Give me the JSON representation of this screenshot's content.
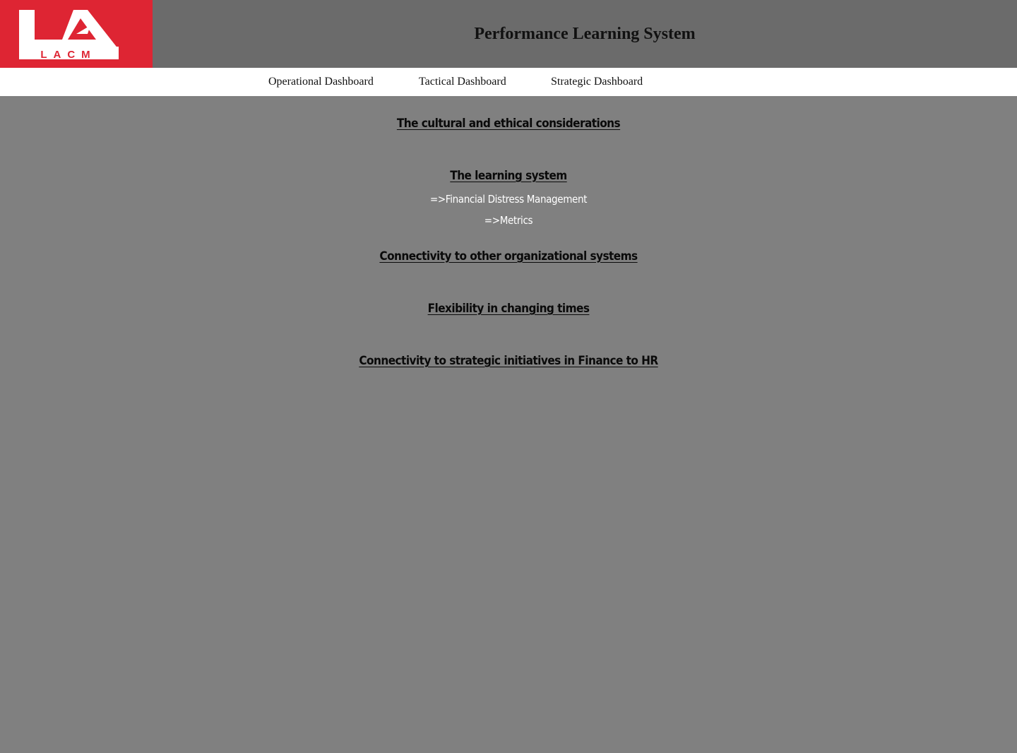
{
  "header": {
    "logo_text": "LACM",
    "title": "Performance Learning System",
    "brand_color": "#de2533"
  },
  "nav": {
    "items": [
      {
        "label": "Operational Dashboard"
      },
      {
        "label": "Tactical Dashboard"
      },
      {
        "label": "Strategic Dashboard"
      }
    ]
  },
  "main": {
    "sections": [
      {
        "heading": "The cultural and ethical considerations"
      },
      {
        "heading": "The learning system",
        "links": [
          "=>Financial Distress Management",
          "=>Metrics"
        ]
      },
      {
        "heading": "Connectivity to other organizational systems"
      },
      {
        "heading": "Flexibility in changing times"
      },
      {
        "heading": "Connectivity to strategic initiatives in Finance to HR"
      }
    ]
  }
}
